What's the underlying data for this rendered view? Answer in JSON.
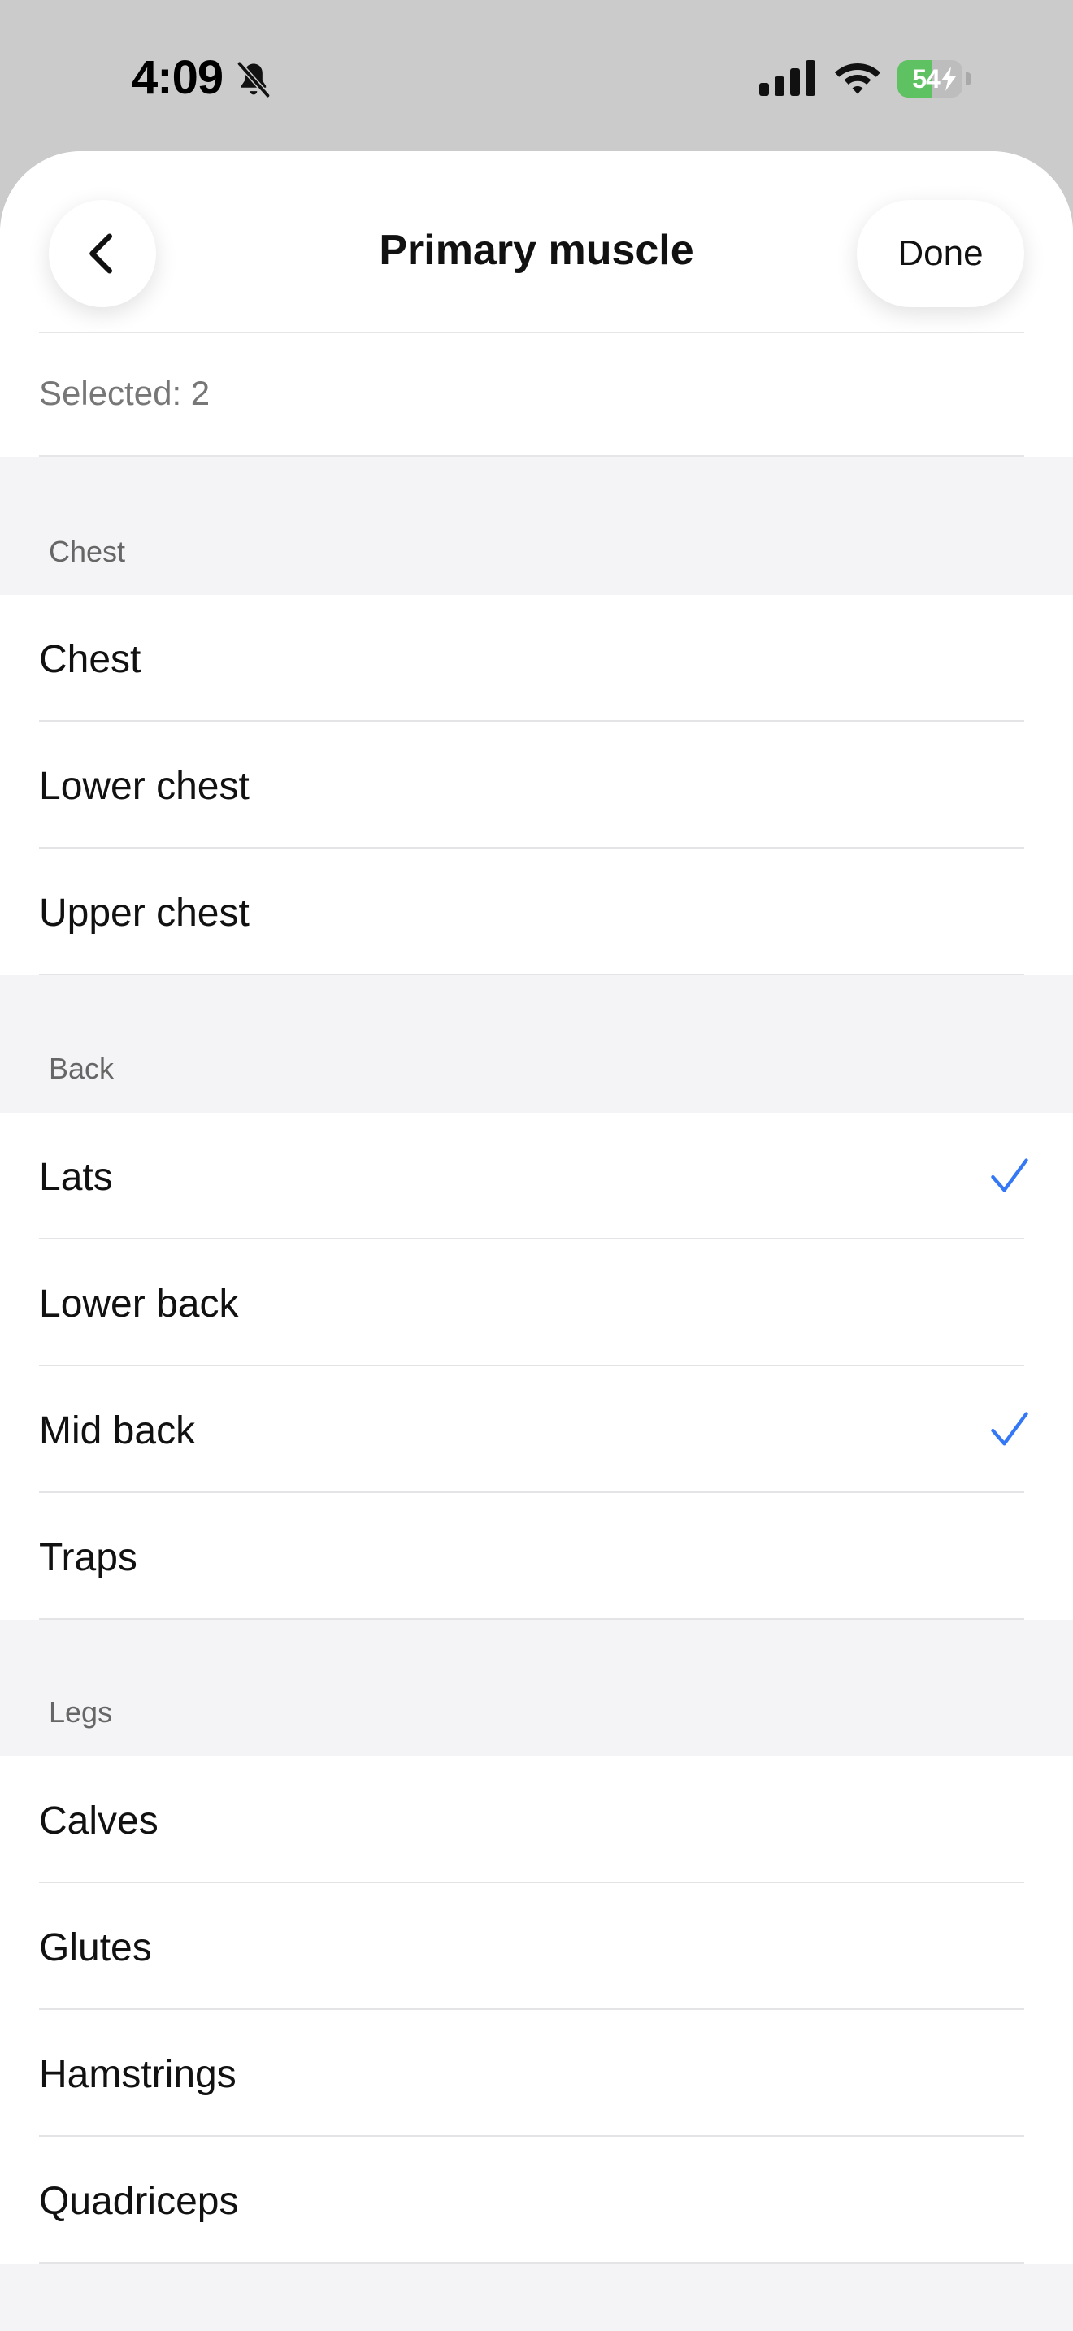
{
  "status_bar": {
    "time": "4:09",
    "battery_level": "54",
    "battery_fraction": 0.54,
    "silent_icon": "bell-slash-icon",
    "signal_icon": "cellular-signal-icon",
    "wifi_icon": "wifi-icon"
  },
  "header": {
    "title": "Primary muscle",
    "done_label": "Done",
    "back_icon": "chevron-left-icon",
    "selected_text": "Selected: 2"
  },
  "sections": [
    {
      "title": "Chest",
      "items": [
        {
          "label": "Chest",
          "checked": false
        },
        {
          "label": "Lower chest",
          "checked": false
        },
        {
          "label": "Upper chest",
          "checked": false
        }
      ]
    },
    {
      "title": "Back",
      "items": [
        {
          "label": "Lats",
          "checked": true
        },
        {
          "label": "Lower back",
          "checked": false
        },
        {
          "label": "Mid back",
          "checked": true
        },
        {
          "label": "Traps",
          "checked": false
        }
      ]
    },
    {
      "title": "Legs",
      "items": [
        {
          "label": "Calves",
          "checked": false
        },
        {
          "label": "Glutes",
          "checked": false
        },
        {
          "label": "Hamstrings",
          "checked": false
        },
        {
          "label": "Quadriceps",
          "checked": false
        }
      ]
    }
  ],
  "colors": {
    "accent": "#3478f6",
    "battery_green": "#5ec262",
    "background_dim": "#cbcbcb",
    "grouped_background": "#f4f4f6"
  }
}
